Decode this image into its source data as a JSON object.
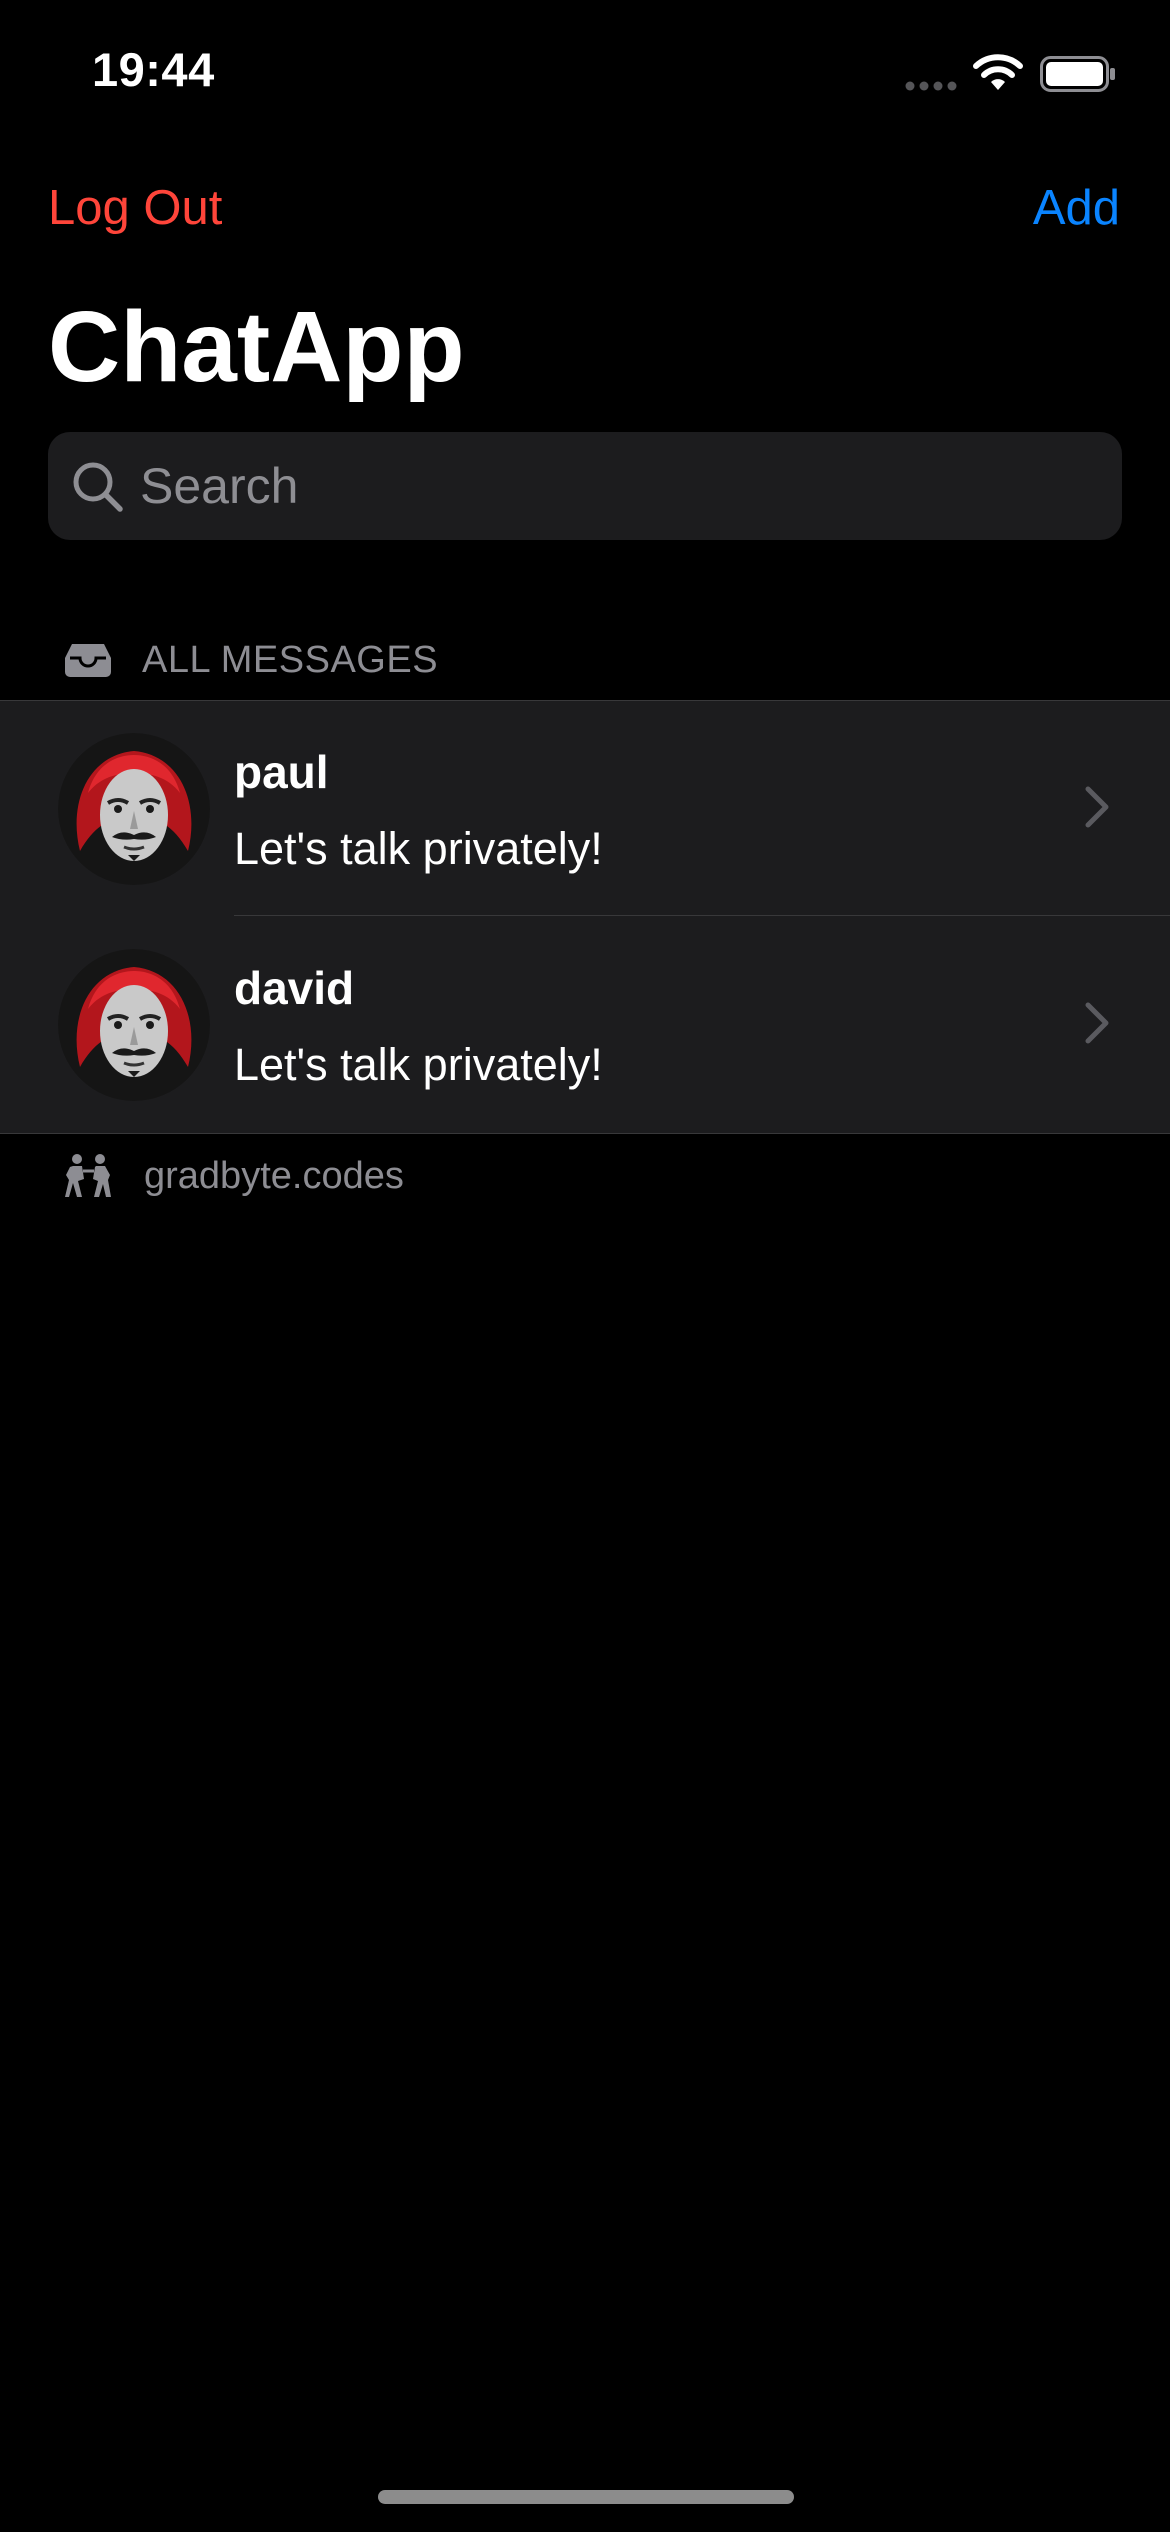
{
  "status_bar": {
    "time": "19:44"
  },
  "nav": {
    "logout_label": "Log Out",
    "add_label": "Add",
    "title": "ChatApp"
  },
  "search": {
    "placeholder": "Search",
    "value": ""
  },
  "section": {
    "header": "ALL MESSAGES",
    "icon": "tray-icon"
  },
  "conversations": [
    {
      "name": "paul",
      "preview": "Let's talk privately!",
      "avatar": "mask-avatar"
    },
    {
      "name": "david",
      "preview": "Let's talk privately!",
      "avatar": "mask-avatar"
    }
  ],
  "footer": {
    "label": "gradbyte.codes",
    "icon": "people-icon"
  },
  "colors": {
    "background": "#000000",
    "cell_background": "#1c1c1e",
    "destructive": "#ff453a",
    "accent": "#0a84ff",
    "secondary_text": "#8d8d93"
  }
}
